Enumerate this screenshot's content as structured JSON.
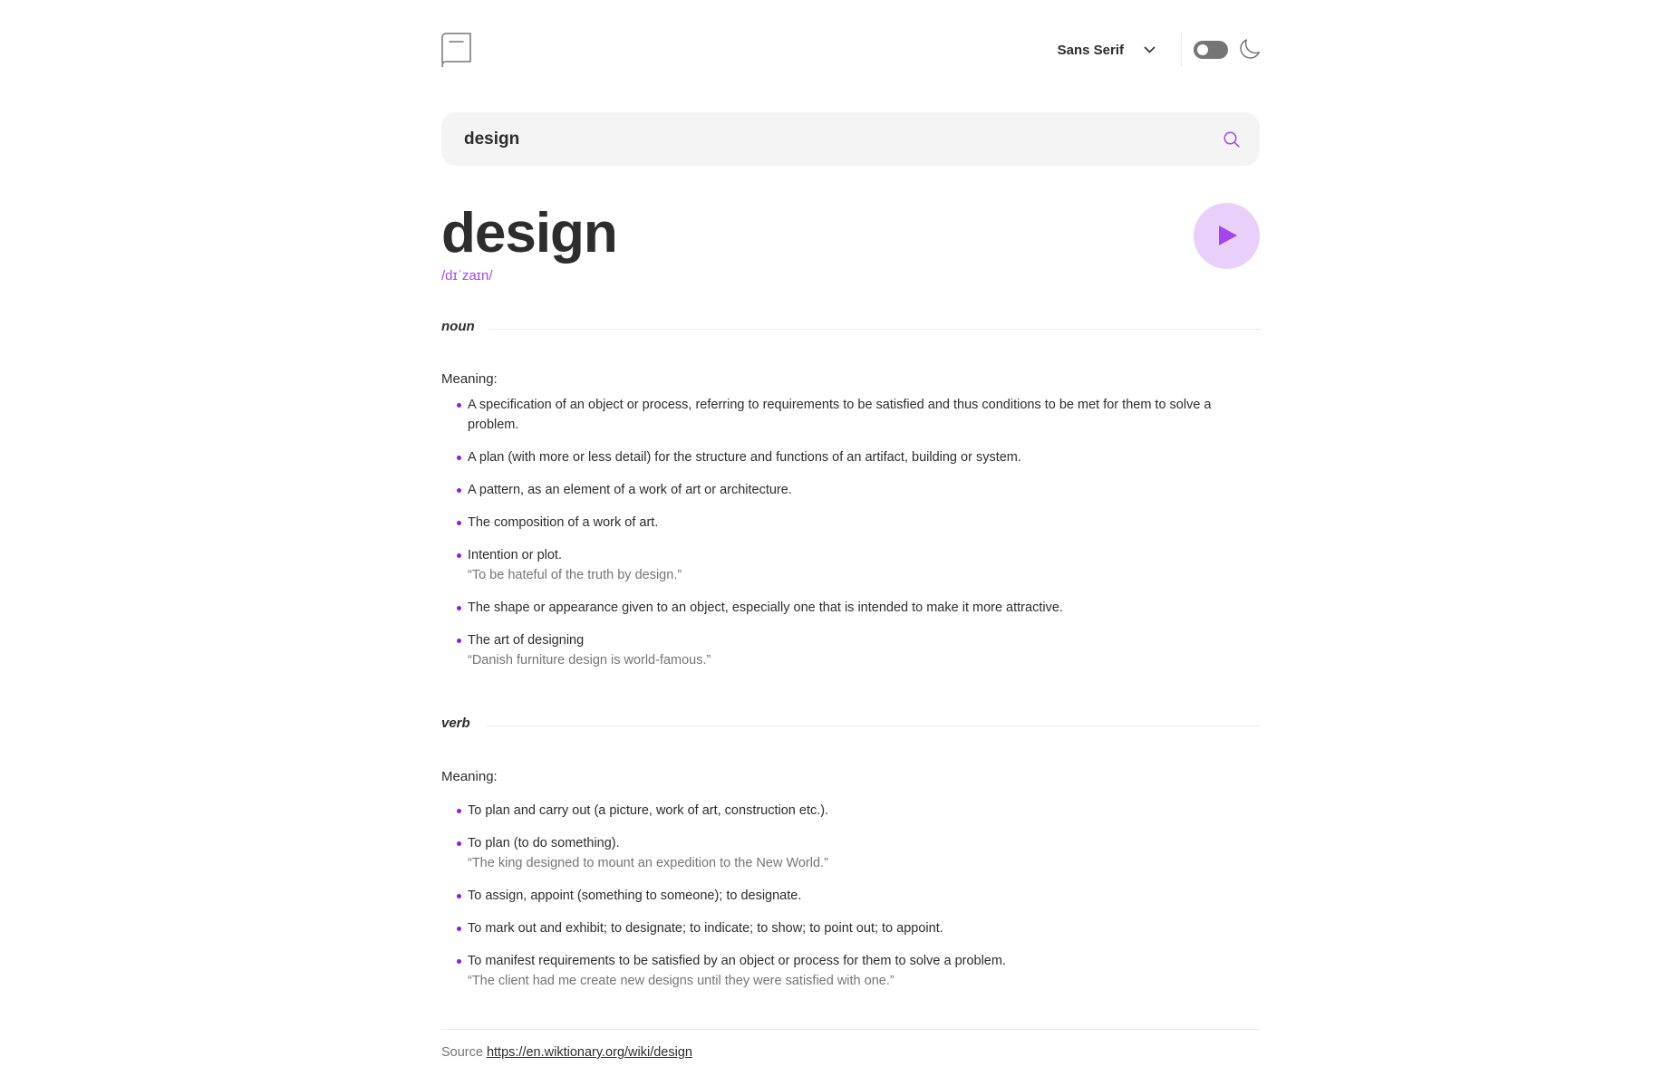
{
  "header": {
    "logo_icon": "book-icon",
    "font_selector": {
      "selected": "Sans Serif",
      "icon": "chevron-down-icon"
    },
    "theme_toggle": {
      "state": "off",
      "icon": "moon-icon"
    }
  },
  "search": {
    "value": "design",
    "icon": "search-icon"
  },
  "entry": {
    "word": "design",
    "phonetic": "/dɪˈzaɪn/",
    "play_icon": "play-icon"
  },
  "noun": {
    "label": "noun",
    "meaning_title": "Meaning:",
    "definitions": [
      {
        "text": "A specification of an object or process, referring to requirements to be satisfied and thus conditions to be met for them to solve a problem.",
        "example": ""
      },
      {
        "text": "A plan (with more or less detail) for the structure and functions of an artifact, building or system.",
        "example": ""
      },
      {
        "text": "A pattern, as an element of a work of art or architecture.",
        "example": ""
      },
      {
        "text": "The composition of a work of art.",
        "example": ""
      },
      {
        "text": "Intention or plot.",
        "example": "“To be hateful of the truth by design.”"
      },
      {
        "text": "The shape or appearance given to an object, especially one that is intended to make it more attractive.",
        "example": ""
      },
      {
        "text": "The art of designing",
        "example": "“Danish furniture design is world-famous.”"
      }
    ]
  },
  "verb": {
    "label": "verb",
    "meaning_title": "Meaning:",
    "definitions": [
      {
        "text": "To plan and carry out (a picture, work of art, construction etc.).",
        "example": ""
      },
      {
        "text": "To plan (to do something).",
        "example": "“The king designed to mount an expedition to the New World.”"
      },
      {
        "text": "To assign, appoint (something to someone); to designate.",
        "example": ""
      },
      {
        "text": "To mark out and exhibit; to designate; to indicate; to show; to point out; to appoint.",
        "example": ""
      },
      {
        "text": "To manifest requirements to be satisfied by an object or process for them to solve a problem.",
        "example": "“The client had me create new designs until they were satisfied with one.”"
      }
    ]
  },
  "footer": {
    "source_label": "Source",
    "source_url": "https://en.wiktionary.org/wiki/design"
  },
  "colors": {
    "accent": "#a445ed",
    "bullet": "#8f19e8",
    "play_bg": "#e9d0fa",
    "text": "#2d2d2d",
    "muted": "#757575",
    "search_bg": "#f4f4f4"
  }
}
